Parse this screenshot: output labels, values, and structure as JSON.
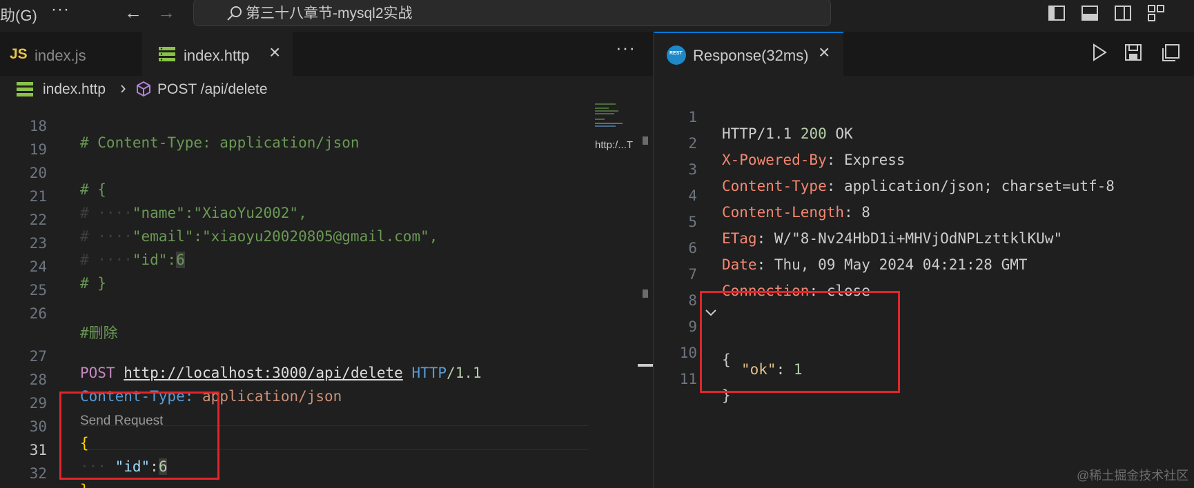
{
  "titlebar": {
    "menu_partial": "助(G)",
    "more": "···",
    "back": "←",
    "forward": "→",
    "search_text": "第三十八章节-mysql2实战"
  },
  "left_tabs": [
    {
      "icon": "JS",
      "label": "index.js",
      "active": false
    },
    {
      "label": "index.http",
      "active": true,
      "close": "×"
    }
  ],
  "left_tab_actions": "···",
  "breadcrumb": {
    "file": "index.http",
    "separator": "›",
    "request": "POST /api/delete"
  },
  "editor": {
    "line_numbers": [
      "18",
      "19",
      "20",
      "21",
      "22",
      "23",
      "24",
      "25",
      "26",
      "27",
      "28",
      "29",
      "30",
      "31",
      "32"
    ],
    "line18": "# Content-Type: application/json",
    "line20": "# {",
    "line21_prefix": "# ····",
    "line21_body": "\"name\":\"XiaoYu2002\",",
    "line22_prefix": "# ····",
    "line22_body": "\"email\":\"xiaoyu20020805@gmail.com\",",
    "line23_prefix": "# ····",
    "line23_key": "\"id\":",
    "line23_val": "6",
    "line24": "# }",
    "line26": "#删除",
    "codelens": "Send Request",
    "line27_method": "POST",
    "line27_url": "http://localhost:3000/api/delete",
    "line27_proto": "HTTP",
    "line27_ver": "/1.1",
    "line28_name": "Content-Type:",
    "line28_value": "application/json",
    "line30": "{",
    "line31_indent": "···",
    "line31_key": "\"id\"",
    "line31_colon": ":",
    "line31_val": "6",
    "line32": "}",
    "minimap_label": "http:/...T"
  },
  "response_tab": {
    "icon_text": "REST",
    "label": "Response(32ms)",
    "close": "×"
  },
  "response": {
    "line_numbers": [
      "1",
      "2",
      "3",
      "4",
      "5",
      "6",
      "7",
      "8",
      "9",
      "10",
      "11"
    ],
    "status_proto": "HTTP/1.1",
    "status_code": "200",
    "status_text": "OK",
    "headers": [
      {
        "name": "X-Powered-By",
        "value": ": Express"
      },
      {
        "name": "Content-Type",
        "value": ": application/json; charset=utf-8"
      },
      {
        "name": "Content-Length",
        "value": ": 8"
      },
      {
        "name": "ETag",
        "value": ": W/\"8-Nv24HbD1i+MHVjOdNPLzttklKUw\""
      },
      {
        "name": "Date",
        "value": ": Thu, 09 May 2024 04:21:28 GMT"
      },
      {
        "name": "Connection",
        "value": ": close"
      }
    ],
    "json_open": "{",
    "json_key": "\"ok\"",
    "json_colon": ": ",
    "json_value": "1",
    "json_close": "}"
  },
  "watermark": "@稀土掘金技术社区",
  "colors": {
    "highlight_box": "#e0262b",
    "accent": "#0078d4"
  }
}
